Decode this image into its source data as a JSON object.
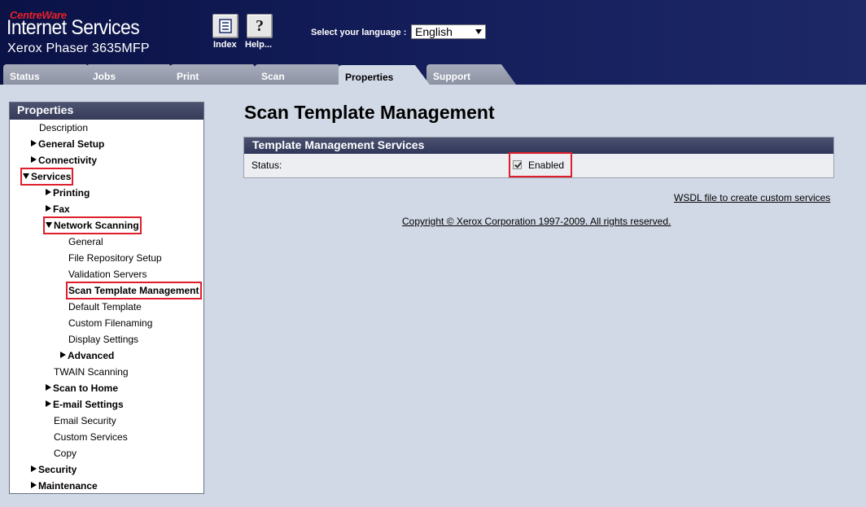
{
  "header": {
    "brand_small": "CentreWare",
    "brand_main": "Internet Services",
    "model": "Xerox Phaser 3635MFP",
    "index_label": "Index",
    "help_label": "Help...",
    "language_label": "Select your language :",
    "language_selected": "English"
  },
  "tabs": [
    {
      "label": "Status"
    },
    {
      "label": "Jobs"
    },
    {
      "label": "Print"
    },
    {
      "label": "Scan"
    },
    {
      "label": "Properties",
      "active": true
    },
    {
      "label": "Support"
    }
  ],
  "sidebar": {
    "title": "Properties",
    "items": [
      {
        "label": "Description"
      },
      {
        "label": "General Setup",
        "arrow": "right"
      },
      {
        "label": "Connectivity",
        "arrow": "right"
      },
      {
        "label": "Services",
        "arrow": "down"
      },
      {
        "label": "Printing",
        "arrow": "right"
      },
      {
        "label": "Fax",
        "arrow": "right"
      },
      {
        "label": "Network Scanning",
        "arrow": "down"
      },
      {
        "label": "General"
      },
      {
        "label": "File Repository Setup"
      },
      {
        "label": "Validation Servers"
      },
      {
        "label": "Scan Template Management",
        "selected": true
      },
      {
        "label": "Default Template"
      },
      {
        "label": "Custom Filenaming"
      },
      {
        "label": "Display Settings"
      },
      {
        "label": "Advanced",
        "arrow": "right"
      },
      {
        "label": "TWAIN Scanning"
      },
      {
        "label": "Scan to Home",
        "arrow": "right"
      },
      {
        "label": "E-mail Settings",
        "arrow": "right"
      },
      {
        "label": "Email Security"
      },
      {
        "label": "Custom Services"
      },
      {
        "label": "Copy"
      },
      {
        "label": "Security",
        "arrow": "right"
      },
      {
        "label": "Maintenance",
        "arrow": "right"
      }
    ]
  },
  "main": {
    "title": "Scan Template Management",
    "panel_title": "Template Management Services",
    "status_label": "Status:",
    "enabled_label": "Enabled",
    "enabled_checked": true,
    "wsdl_link": "WSDL file to create custom services",
    "copyright": "Copyright © Xerox Corporation 1997-2009. All rights reserved."
  },
  "colors": {
    "header_bg": "#0a1246",
    "page_bg": "#d2d9e6",
    "highlight": "#e01e2b",
    "brand_red": "#e8202a"
  }
}
